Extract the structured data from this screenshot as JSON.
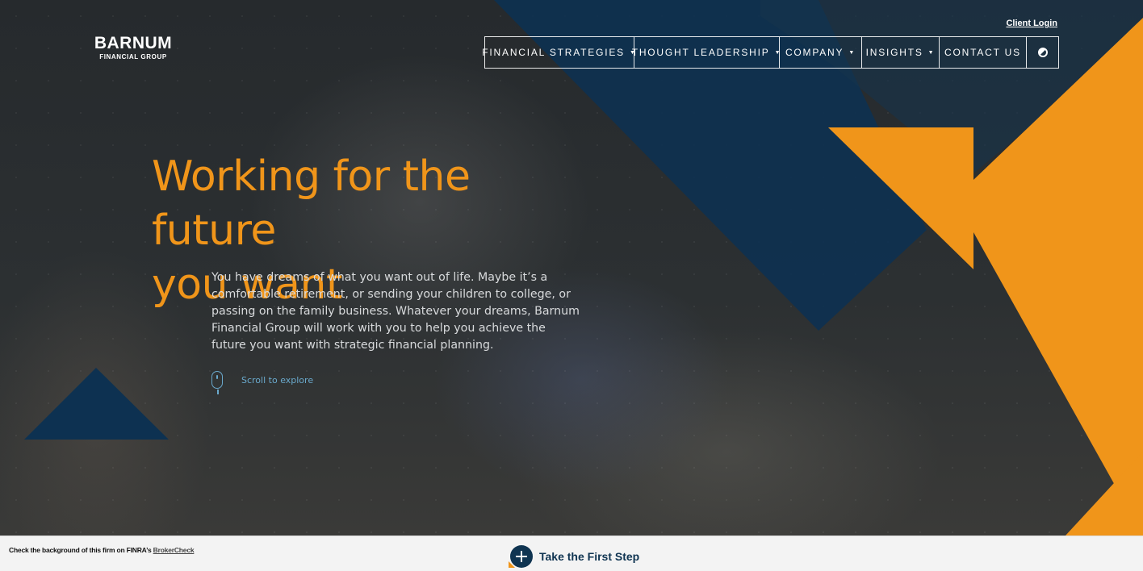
{
  "brand": {
    "name": "BARNUM",
    "tagline": "FINANCIAL GROUP"
  },
  "header": {
    "client_login": "Client Login"
  },
  "nav": {
    "items": [
      {
        "label": "FINANCIAL STRATEGIES",
        "dropdown": true
      },
      {
        "label": "THOUGHT LEADERSHIP",
        "dropdown": true
      },
      {
        "label": "COMPANY",
        "dropdown": true
      },
      {
        "label": "INSIGHTS",
        "dropdown": true
      },
      {
        "label": "CONTACT US",
        "dropdown": false
      }
    ],
    "caret": "▼",
    "search_icon": "search-icon"
  },
  "hero": {
    "headline_line1": "Working for the future",
    "headline_line2": "you want",
    "intro": "You have dreams of what you want out of life. Maybe it’s a comfortable retirement, or sending your children to college, or passing on the family business. Whatever your dreams, Barnum Financial Group will work with you to help you achieve the future you want with strategic financial planning.",
    "scroll_label": "Scroll to explore"
  },
  "footer": {
    "finra_text": "Check the background of this firm on FINRA’s ",
    "finra_link": "BrokerCheck",
    "cta_label": "Take the First Step"
  },
  "colors": {
    "accent_orange": "#f0951a",
    "navy": "#0f3451",
    "link_blue": "#6aa9cc"
  }
}
